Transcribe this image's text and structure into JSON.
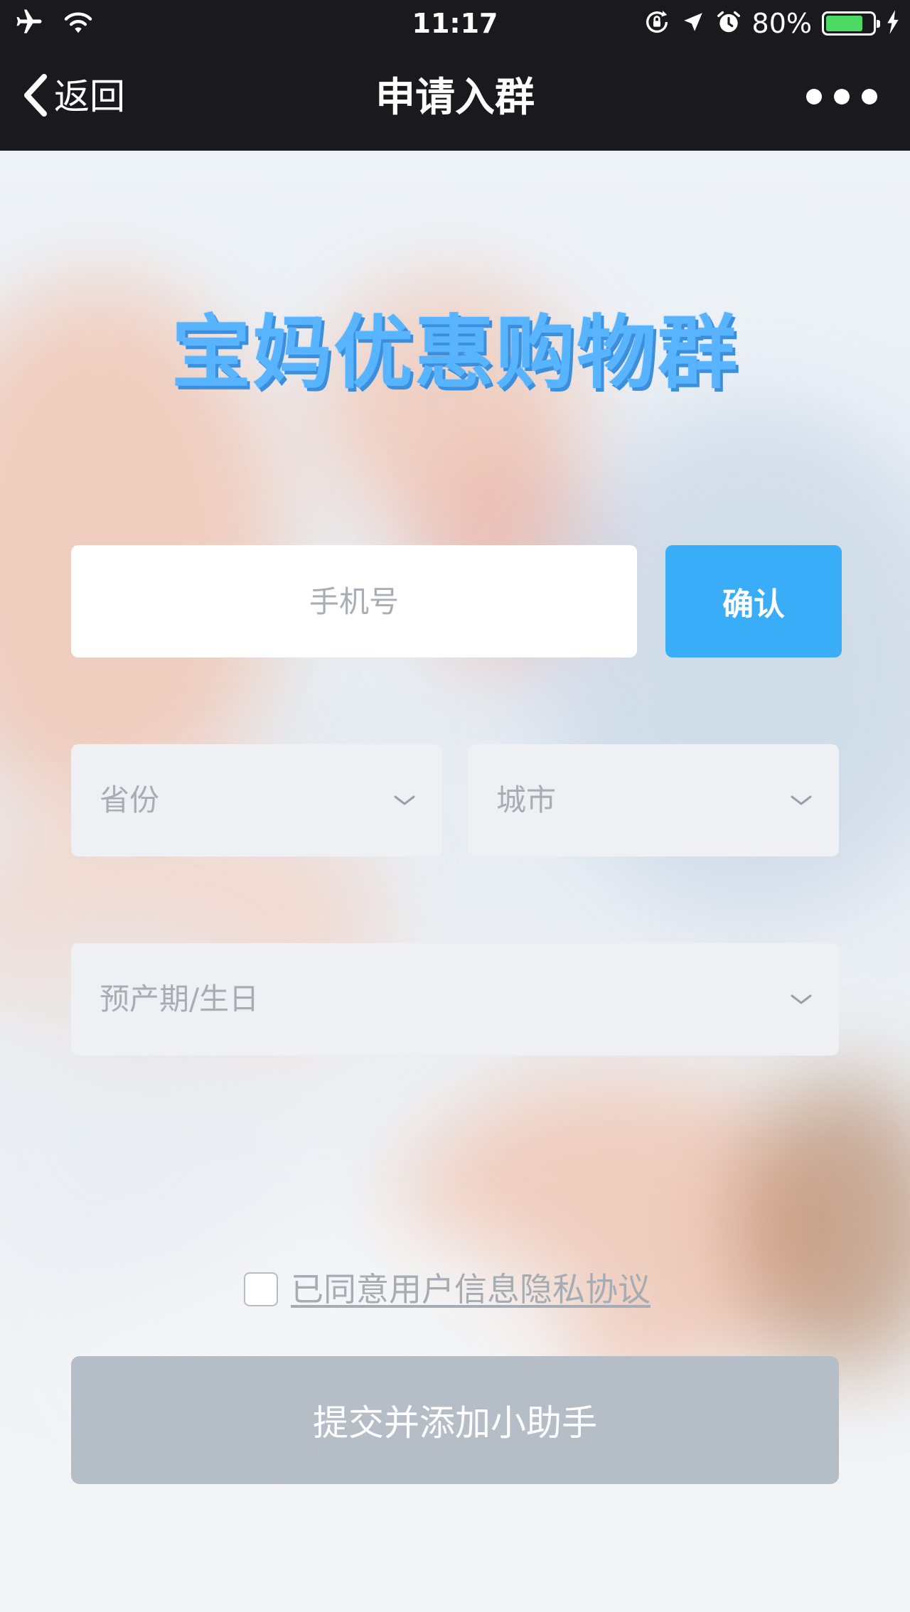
{
  "status_bar": {
    "time": "11:17",
    "battery_percent": "80%",
    "battery_level": 0.8,
    "icons": [
      "airplane-icon",
      "wifi-icon",
      "rotation-lock-icon",
      "location-arrow-icon",
      "alarm-icon",
      "battery-icon",
      "charging-bolt-icon"
    ]
  },
  "nav": {
    "back_label": "返回",
    "title": "申请入群",
    "more_icon": "more-dots-icon"
  },
  "headline": "宝妈优惠购物群",
  "form": {
    "phone_placeholder": "手机号",
    "confirm_label": "确认",
    "province_placeholder": "省份",
    "city_placeholder": "城市",
    "due_date_placeholder": "预产期/生日",
    "agree_label": "已同意用户信息隐私协议",
    "agree_checked": false,
    "submit_label": "提交并添加小助手"
  },
  "colors": {
    "topbar_bg": "#1a191e",
    "headline": "#58b4ff",
    "confirm_bg": "#3aadf8",
    "submit_bg": "#b5bdc7",
    "select_bg": "#eef0f3",
    "battery_fill": "#4cd964"
  }
}
